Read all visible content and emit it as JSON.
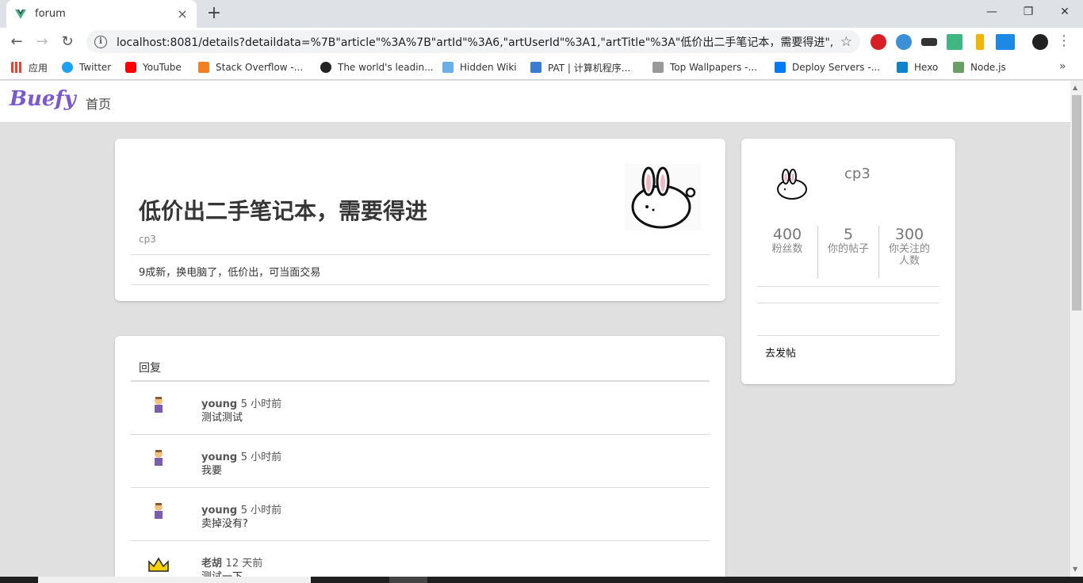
{
  "browser": {
    "tab_title": "forum",
    "tab_close": "×",
    "new_tab": "+",
    "url": "localhost:8081/details?detaildata=%7B\"article\"%3A%7B\"artId\"%3A6,\"artUserId\"%3A1,\"artTitle\"%3A\"低价出二手笔记本，需要得进\",\"art...",
    "bookmarks": [
      "应用",
      "Twitter",
      "YouTube",
      "Stack Overflow -...",
      "The world's leadin...",
      "Hidden Wiki",
      "PAT | 计算机程序...",
      "Top Wallpapers -...",
      "Deploy Servers -...",
      "Hexo",
      "Node.js"
    ],
    "bookmarks_more": "»"
  },
  "navbar": {
    "logo": "Buefy",
    "home": "首页"
  },
  "article": {
    "title": "低价出二手笔记本，需要得进",
    "author": "cp3",
    "content": "9成新，换电脑了，低价出，可当面交易"
  },
  "replies": {
    "heading": "回复",
    "items": [
      {
        "name": "young",
        "time": "5 小时前",
        "body": "测试测试"
      },
      {
        "name": "young",
        "time": "5 小时前",
        "body": "我要"
      },
      {
        "name": "young",
        "time": "5 小时前",
        "body": "卖掉没有?"
      },
      {
        "name": "老胡",
        "time": "12 天前",
        "body": "测试一下"
      }
    ]
  },
  "profile": {
    "name": "cp3",
    "stats": [
      {
        "num": "400",
        "label": "粉丝数"
      },
      {
        "num": "5",
        "label": "你的帖子"
      },
      {
        "num": "300",
        "label": "你关注的人数"
      }
    ],
    "post_link": "去发帖"
  },
  "colors": {
    "brand": "#7957d5",
    "background": "#e0e0e0"
  }
}
